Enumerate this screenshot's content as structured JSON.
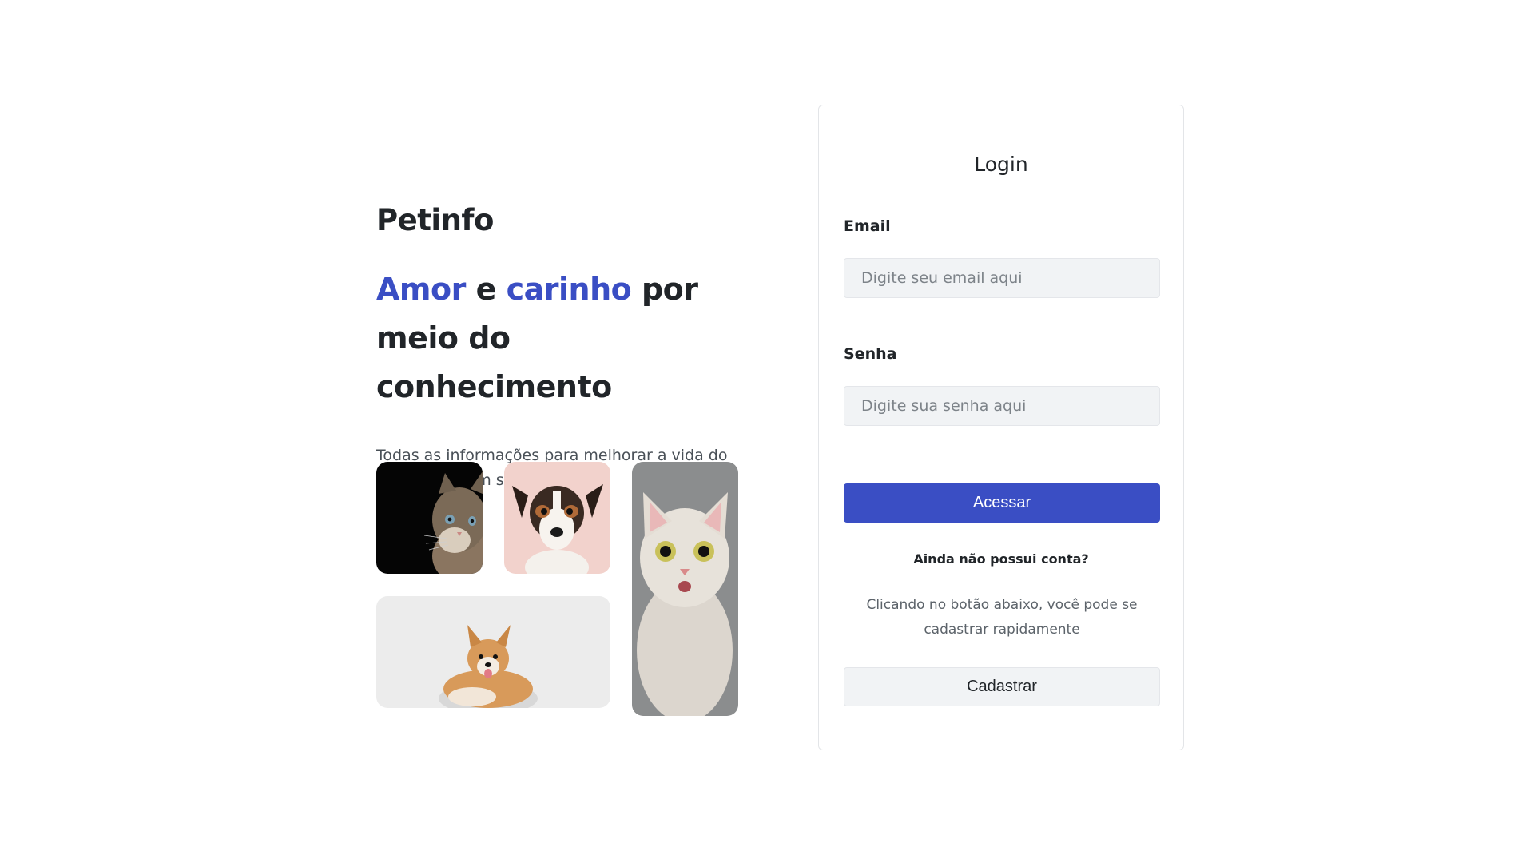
{
  "hero": {
    "brand": "Petinfo",
    "headline_part1": "Amor",
    "headline_part2": " e ",
    "headline_part3": "carinho",
    "headline_part4": " por meio do conhecimento",
    "tagline": "Todas as informações para melhorar a vida do seu pet em um só lugar",
    "accent_color": "#3a4ec4"
  },
  "photos": [
    {
      "subject": "cat"
    },
    {
      "subject": "dog"
    },
    {
      "subject": "corgi"
    },
    {
      "subject": "surprised-cat"
    }
  ],
  "login": {
    "title": "Login",
    "email_label": "Email",
    "email_placeholder": "Digite seu email aqui",
    "password_label": "Senha",
    "password_placeholder": "Digite sua senha aqui",
    "submit_label": "Acessar",
    "no_account_text": "Ainda não possui conta?",
    "signup_hint": "Clicando no botão abaixo, você pode se cadastrar rapidamente",
    "signup_label": "Cadastrar",
    "primary_color": "#3a4ec4"
  }
}
